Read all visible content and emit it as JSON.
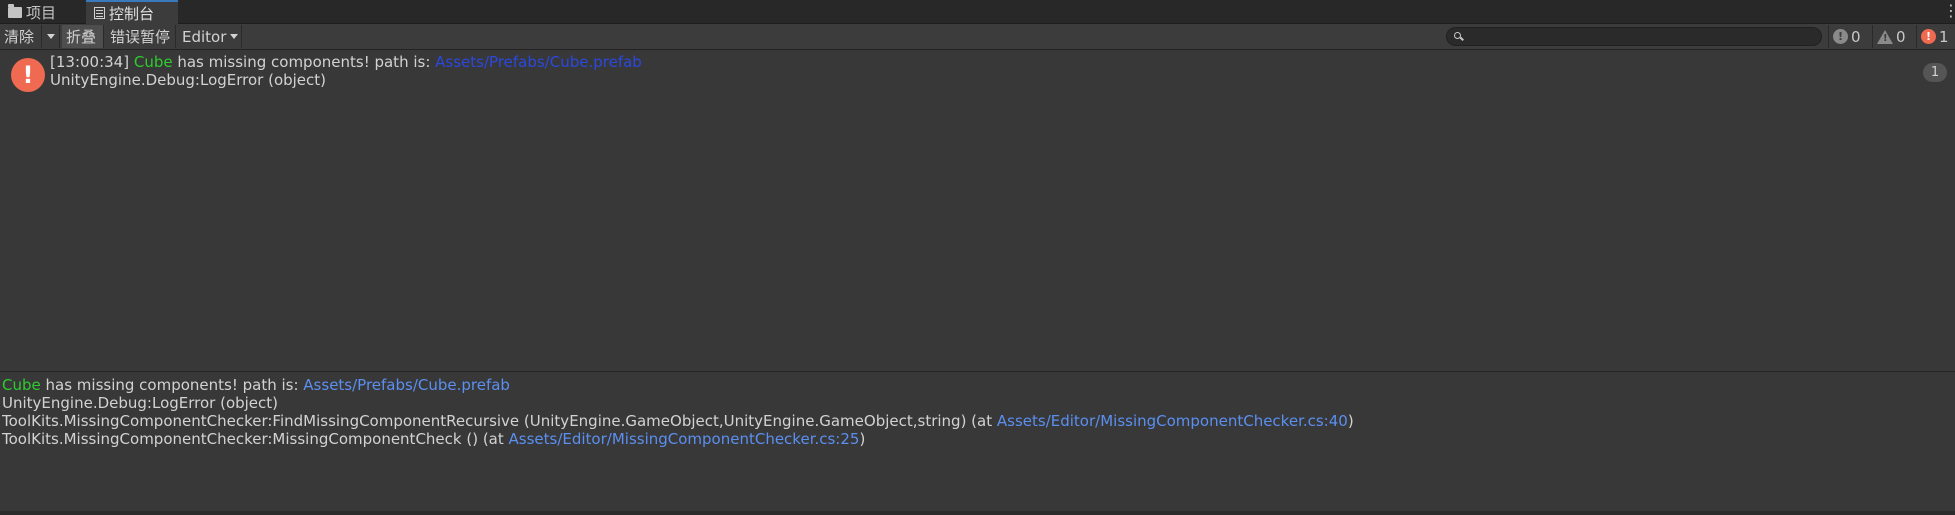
{
  "tabs": [
    {
      "label": "项目",
      "icon": "folder-icon"
    },
    {
      "label": "控制台",
      "icon": "console-icon",
      "active": true
    }
  ],
  "toolbar": {
    "clear_label": "清除",
    "collapse_label": "折叠",
    "error_pause_label": "错误暂停",
    "editor_label": "Editor",
    "search_placeholder": "",
    "counts": {
      "info": "0",
      "warning": "0",
      "error": "1"
    }
  },
  "log_entry": {
    "timestamp": "[13:00:34]",
    "object_name": "Cube",
    "message": " has missing components! path is: ",
    "path": "Assets/Prefabs/Cube.prefab",
    "line2": "UnityEngine.Debug:LogError (object)",
    "count": "1"
  },
  "detail": {
    "object_name": "Cube",
    "message": " has missing components! path is: ",
    "path": "Assets/Prefabs/Cube.prefab",
    "line2": "UnityEngine.Debug:LogError (object)",
    "line3_prefix": "ToolKits.MissingComponentChecker:FindMissingComponentRecursive (UnityEngine.GameObject,UnityEngine.GameObject,string) (at ",
    "line3_link": "Assets/Editor/MissingComponentChecker.cs:40",
    "line3_suffix": ")",
    "line4_prefix": "ToolKits.MissingComponentChecker:MissingComponentCheck () (at ",
    "line4_link": "Assets/Editor/MissingComponentChecker.cs:25",
    "line4_suffix": ")"
  },
  "colors": {
    "background": "#383838",
    "object_name": "#2ecc2e",
    "link": "#5b8ff0",
    "error": "#ef6a50"
  }
}
